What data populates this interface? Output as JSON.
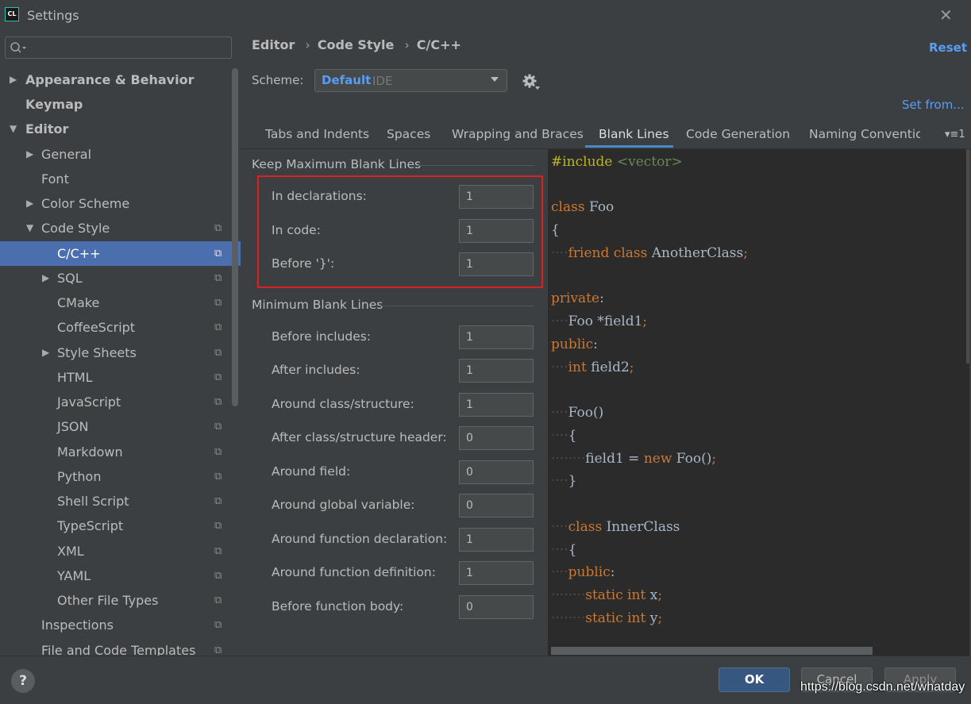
{
  "window": {
    "title": "Settings",
    "app_icon": "CL"
  },
  "search": {
    "placeholder": ""
  },
  "sidebar": {
    "items": [
      {
        "label": "Appearance & Behavior"
      },
      {
        "label": "Keymap"
      },
      {
        "label": "Editor"
      },
      {
        "label": "General"
      },
      {
        "label": "Font"
      },
      {
        "label": "Color Scheme"
      },
      {
        "label": "Code Style"
      },
      {
        "label": "C/C++"
      },
      {
        "label": "SQL"
      },
      {
        "label": "CMake"
      },
      {
        "label": "CoffeeScript"
      },
      {
        "label": "Style Sheets"
      },
      {
        "label": "HTML"
      },
      {
        "label": "JavaScript"
      },
      {
        "label": "JSON"
      },
      {
        "label": "Markdown"
      },
      {
        "label": "Python"
      },
      {
        "label": "Shell Script"
      },
      {
        "label": "TypeScript"
      },
      {
        "label": "XML"
      },
      {
        "label": "YAML"
      },
      {
        "label": "Other File Types"
      },
      {
        "label": "Inspections"
      },
      {
        "label": "File and Code Templates"
      }
    ]
  },
  "breadcrumb": [
    "Editor",
    "Code Style",
    "C/C++"
  ],
  "reset_label": "Reset",
  "scheme": {
    "label": "Scheme:",
    "name": "Default",
    "kind": "IDE"
  },
  "set_from_label": "Set from...",
  "tabs": [
    "Tabs and Indents",
    "Spaces",
    "Wrapping and Braces",
    "Blank Lines",
    "Code Generation",
    "Naming Conventior"
  ],
  "tabs_more": "▾≡1",
  "active_tab": "Blank Lines",
  "keep_max": {
    "title": "Keep Maximum Blank Lines",
    "options": [
      {
        "label": "In declarations:",
        "value": "1"
      },
      {
        "label": "In code:",
        "value": "1"
      },
      {
        "label": "Before '}':",
        "value": "1"
      }
    ]
  },
  "min_blank": {
    "title": "Minimum Blank Lines",
    "options": [
      {
        "label": "Before includes:",
        "value": "1"
      },
      {
        "label": "After includes:",
        "value": "1"
      },
      {
        "label": "Around class/structure:",
        "value": "1"
      },
      {
        "label": "After class/structure header:",
        "value": "0"
      },
      {
        "label": "Around field:",
        "value": "0"
      },
      {
        "label": "Around global variable:",
        "value": "0"
      },
      {
        "label": "Around function declaration:",
        "value": "1"
      },
      {
        "label": "Around function definition:",
        "value": "1"
      },
      {
        "label": "Before function body:",
        "value": "0"
      }
    ]
  },
  "code": {
    "include_kw": "#include",
    "include_target": "<vector>",
    "class_kw": "class",
    "class_name": "Foo",
    "open_brace": "{",
    "close_brace": "}",
    "friend_kw": "friend",
    "another_class": "AnotherClass",
    "semicolon": ";",
    "private_kw": "private",
    "public_kw": "public",
    "colon": ":",
    "foo_type": "Foo",
    "field1_decl": "*field1",
    "int_kw": "int",
    "field2": "field2",
    "ctor": "Foo()",
    "field1_assign": "field1 = ",
    "new_kw": "new",
    "foo_call": "Foo()",
    "inner_class": "InnerClass",
    "static_kw": "static",
    "var_x": "x",
    "var_y": "y"
  },
  "footer": {
    "help": "?",
    "ok": "OK",
    "cancel": "Cancel",
    "apply": "Apply"
  },
  "watermark": "https://blog.csdn.net/whatday",
  "colors": {
    "accent": "#589df6",
    "selection": "#4b6eaf",
    "highlight_box": "#e01f1f",
    "ok_button": "#365880"
  }
}
